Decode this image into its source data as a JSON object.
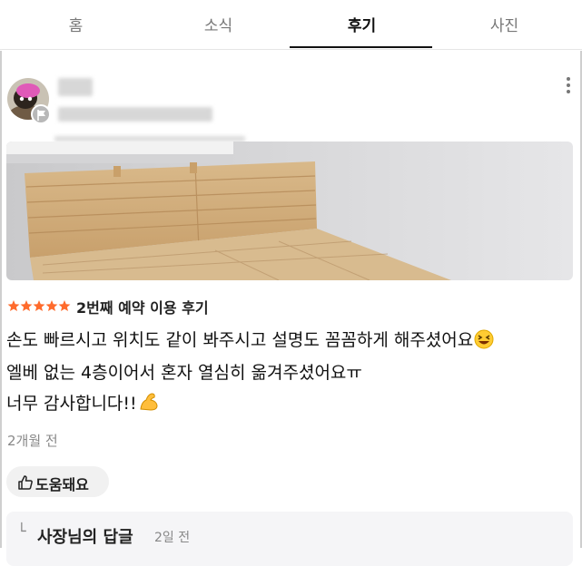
{
  "tabs": [
    {
      "label": "홈",
      "active": false
    },
    {
      "label": "소식",
      "active": false
    },
    {
      "label": "후기",
      "active": true
    },
    {
      "label": "사진",
      "active": false
    }
  ],
  "review": {
    "rating": 5,
    "rating_max": 5,
    "visit_label": "2번째 예약 이용 후기",
    "lines": [
      "손도 빠르시고 위치도 같이 봐주시고 설명도 꼼꼼하게 해주셨어요",
      "엘베 없는 4층이어서 혼자 열심히 옮겨주셨어요ㅠ",
      "너무 감사합니다!!"
    ],
    "line_emojis": [
      "grinning-squinting-face-icon",
      null,
      "flexed-biceps-icon"
    ],
    "time_ago": "2개월 전",
    "helpful_label": "도움돼요"
  },
  "owner_reply": {
    "title": "사장님의 답글",
    "time_ago": "2일 전"
  },
  "colors": {
    "star": "#ff6b2c",
    "active_tab": "#111111",
    "muted": "#888888",
    "reply_bg": "#f5f5f7",
    "helpful_bg": "#f1f1f1"
  }
}
